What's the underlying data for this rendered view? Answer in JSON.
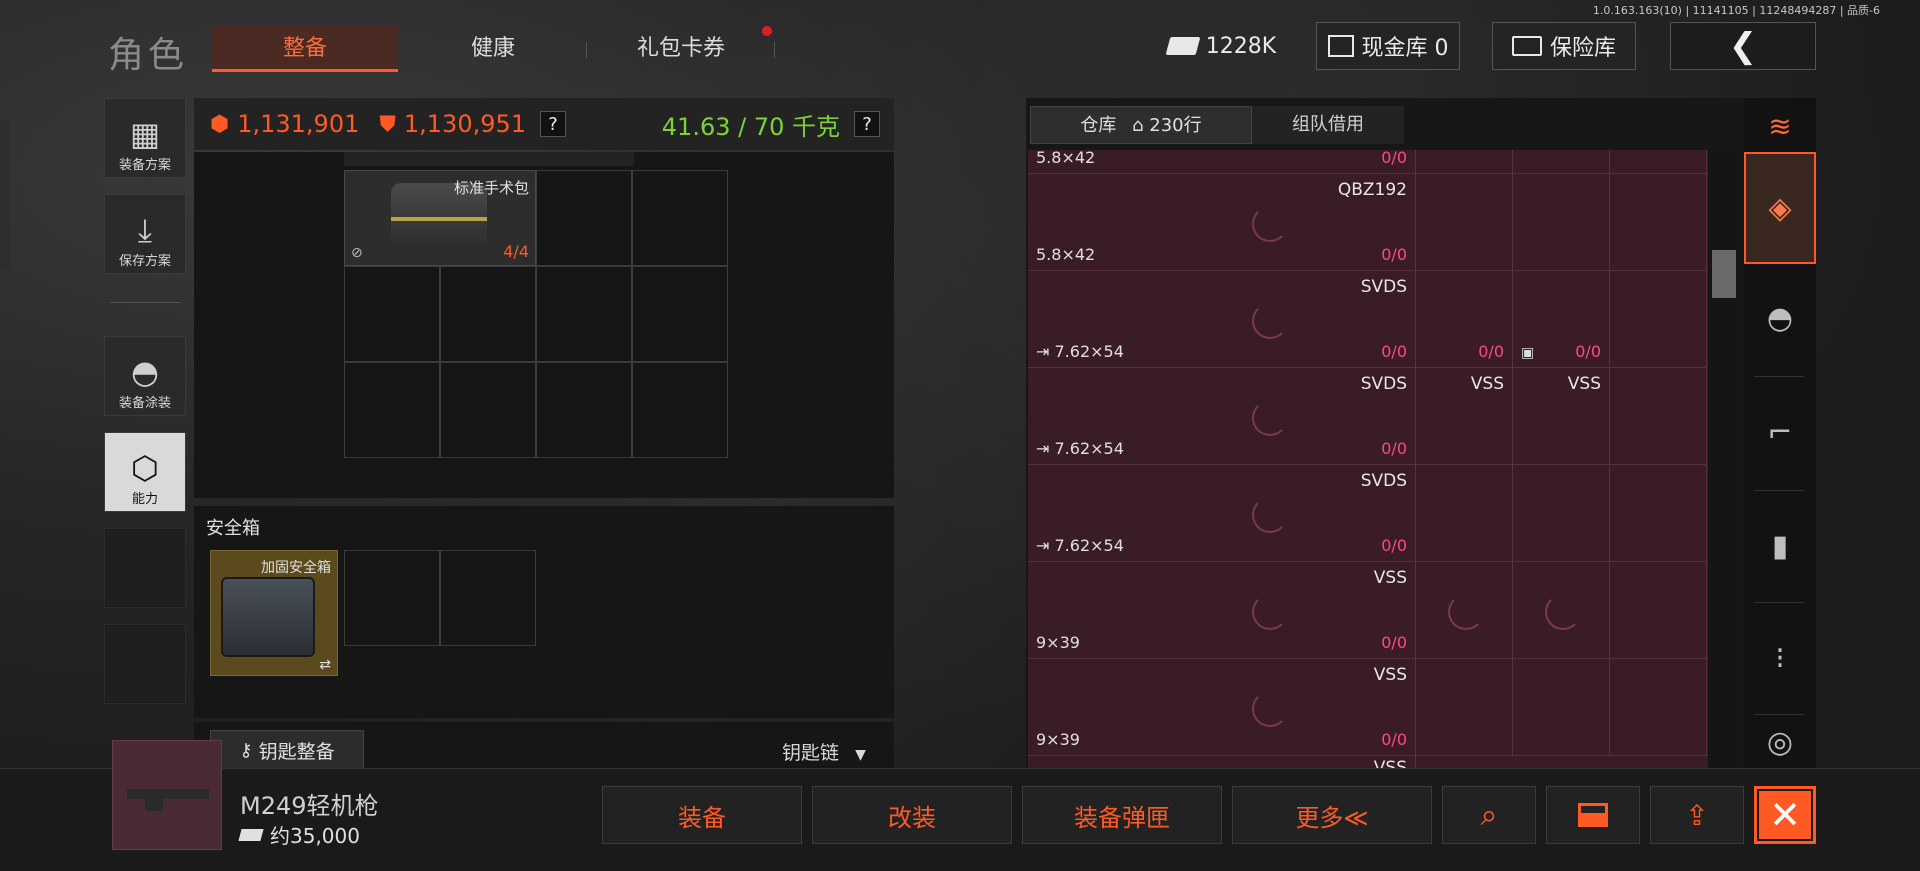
{
  "version": "1.0.163.163(10) | 11141105 | 11248494287 | 品质-6",
  "header": {
    "title": "角色",
    "tabs": [
      {
        "label": "整备",
        "active": true
      },
      {
        "label": "健康",
        "active": false
      },
      {
        "label": "礼包卡券",
        "active": false,
        "badge": true
      }
    ],
    "cash": "1228K",
    "cash_vault": "现金库 0",
    "safe_vault": "保险库",
    "back_icon": "❮"
  },
  "sidebar": {
    "items": [
      {
        "label": "装备方案",
        "icon": "vest-icon"
      },
      {
        "label": "保存方案",
        "icon": "download-icon"
      },
      {
        "label": "装备涂装",
        "icon": "helmet-icon"
      },
      {
        "label": "能力",
        "icon": "ability-icon",
        "active": true
      }
    ]
  },
  "stats": {
    "backpack_value": "1,131,901",
    "armor_value": "1,130,951",
    "help": "?",
    "weight": "41.63 / 70 千克",
    "help2": "?"
  },
  "inventory": {
    "bag_item": {
      "label": "标准手术包",
      "count": "4/4"
    }
  },
  "safe_box": {
    "title": "安全箱",
    "item_label": "加固安全箱",
    "swap_icon": "⇄"
  },
  "keys": {
    "key_button": "钥匙整备",
    "keychain": "钥匙链"
  },
  "selected_item": {
    "name": "M249轻机枪",
    "price": "约35,000"
  },
  "actions": {
    "equip": "装备",
    "modify": "改装",
    "equip_mag": "装备弹匣",
    "more": "更多≪",
    "search_icon": "⌕",
    "close_icon": "✕"
  },
  "warehouse": {
    "tab_warehouse": "仓库",
    "rows_count": "230行",
    "tab_team": "组队借用",
    "rows": [
      {
        "weapon": "",
        "ammo": "5.8×42",
        "count": "0/0",
        "extra": []
      },
      {
        "weapon": "QBZ192",
        "ammo": "5.8×42",
        "count": "0/0",
        "extra": []
      },
      {
        "weapon": "SVDS",
        "ammo": "7.62×54",
        "count": "0/0",
        "extra": [
          {
            "label": "",
            "count": "0/0"
          },
          {
            "label": "",
            "count": "0/0"
          }
        ]
      },
      {
        "weapon": "SVDS",
        "ammo": "7.62×54",
        "count": "0/0",
        "extra": [
          {
            "label": "VSS",
            "count": ""
          },
          {
            "label": "VSS",
            "count": ""
          }
        ]
      },
      {
        "weapon": "SVDS",
        "ammo": "7.62×54",
        "count": "0/0",
        "extra": []
      },
      {
        "weapon": "VSS",
        "ammo": "9×39",
        "count": "0/0",
        "extra": []
      },
      {
        "weapon": "VSS",
        "ammo": "9×39",
        "count": "0/0",
        "extra": []
      }
    ],
    "last_row_partial": "VSS"
  },
  "right_rail": {
    "icons": [
      "stack-refresh-icon",
      "stack-icon",
      "helmet-icon",
      "rifle-icon",
      "magazine-icon",
      "bullet-icon",
      "scope-icon"
    ]
  },
  "colors": {
    "accent": "#ff5a24",
    "weight_green": "#7cd23a",
    "count_red": "#ff4a7a"
  }
}
